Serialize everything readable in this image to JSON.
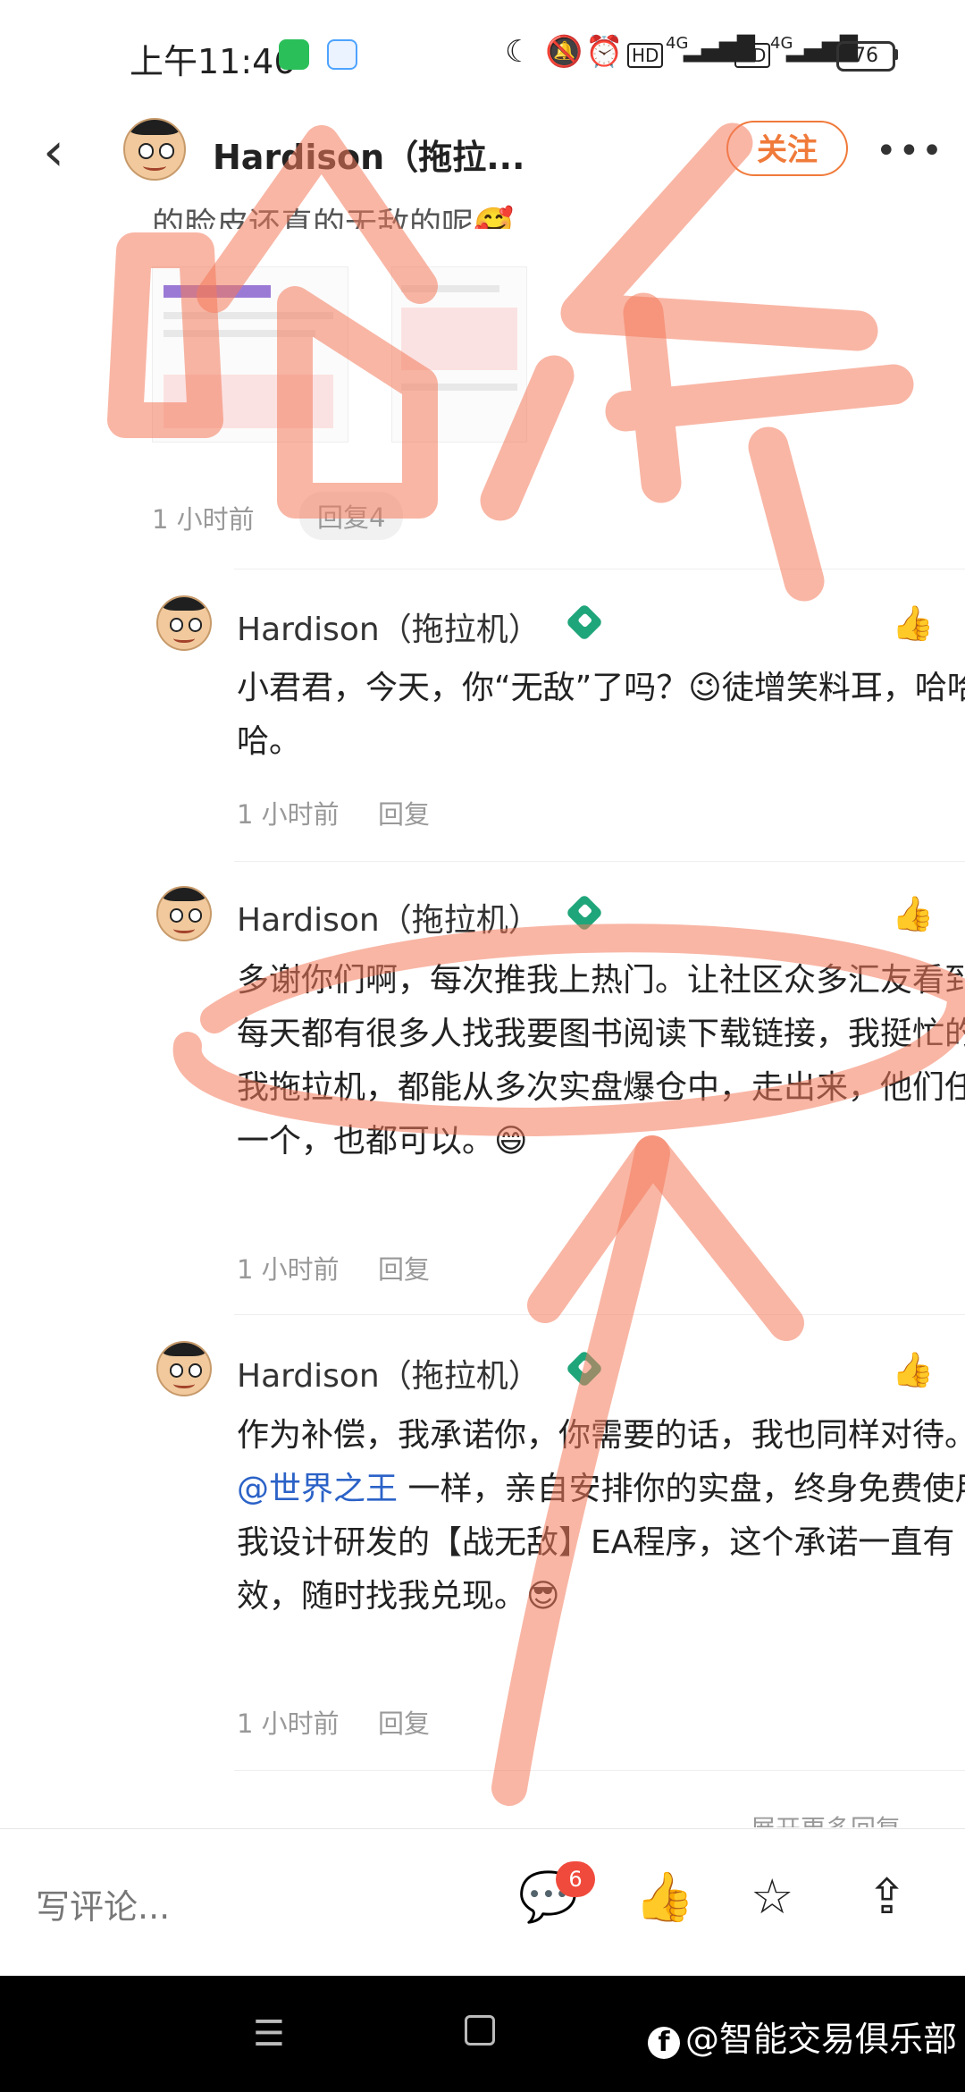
{
  "status_bar": {
    "time": "上午11:46",
    "network1": "4G",
    "network2": "4G",
    "hd1": "HD",
    "hd2": "HD",
    "battery": "76"
  },
  "header": {
    "title": "Hardison（拖拉...",
    "follow_label": "关注",
    "more_label": "•••"
  },
  "parent_comment": {
    "partial_text": "的脸皮还真的无敌的呢🥰",
    "time": "1 小时前",
    "reply_label": "回复4"
  },
  "replies": [
    {
      "author": "Hardison（拖拉机）",
      "text": "小君君，今天，你“无敌”了吗？😉徒增笑料耳，哈哈哈哈。",
      "time": "1 小时前",
      "reply_label": "回复"
    },
    {
      "author": "Hardison（拖拉机）",
      "text": "多谢你们啊，每次推我上热门。让社区众多汇友看到，每天都有很多人找我要图书阅读下载链接，我挺忙的。我拖拉机，都能从多次实盘爆仓中，走出来，他们任何一个，也都可以。😄",
      "time": "1 小时前",
      "reply_label": "回复"
    },
    {
      "author": "Hardison（拖拉机）",
      "text_before": "作为补偿，我承诺你，你需要的话，我也同样对待。与",
      "mention": "@世界之王",
      "text_after": " 一样，亲自安排你的实盘，终身免费使用我设计研发的【战无敌】EA程序，这个承诺一直有效，随时找我兑现。😎",
      "time": "1 小时前",
      "reply_label": "回复"
    }
  ],
  "more_replies_label": "展开更多回复",
  "bottom_bar": {
    "write_placeholder": "写评论...",
    "comment_count": "6"
  },
  "watermark": {
    "text": "@智能交易俱乐部"
  },
  "annotation_overlay": {
    "stroke_color": "#f47a5b",
    "handwriting": "哈哈"
  }
}
